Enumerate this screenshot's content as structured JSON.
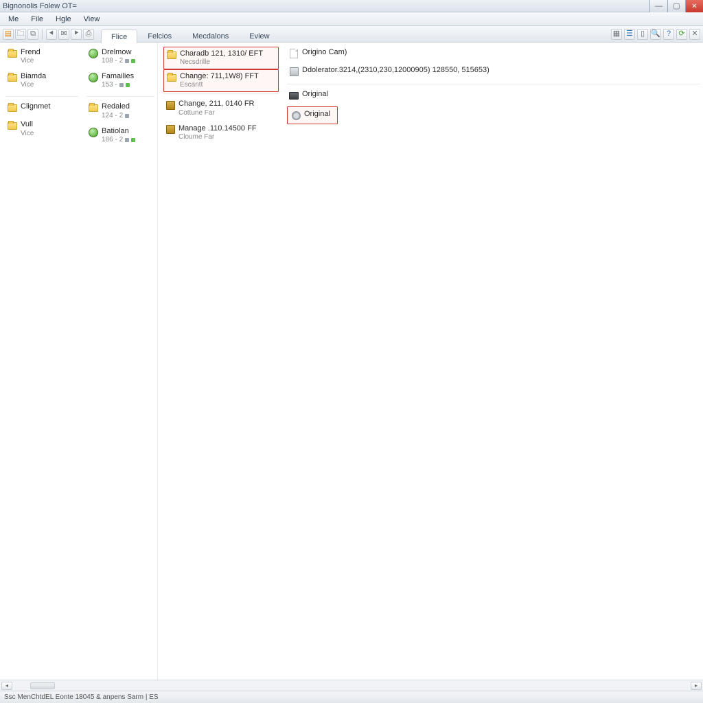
{
  "window": {
    "title": "Bignonolis Folew OT="
  },
  "menu": {
    "items": [
      "Me",
      "File",
      "Hgle",
      "View"
    ]
  },
  "tabs": {
    "items": [
      "Flice",
      "Felcios",
      "Mecdalons",
      "Eview"
    ],
    "active": 0
  },
  "toolbar_right_icons": [
    "calendar-icon",
    "list-icon",
    "page-icon",
    "search-icon",
    "help-icon",
    "refresh-icon",
    "close-small-icon"
  ],
  "col1": [
    {
      "line1": "Frend",
      "line2": "Vice"
    },
    {
      "line1": "Biamda",
      "line2": "Vice"
    },
    {
      "line1": "Clignmet",
      "line2": ""
    },
    {
      "line1": "Vull",
      "line2": "Vice"
    }
  ],
  "col2": [
    {
      "line1": "Drelmow",
      "line2": "108 - 2",
      "badge": true
    },
    {
      "line1": "Famailies",
      "line2": "153 -",
      "badge": true
    },
    {
      "line1": "Redaled",
      "line2": "124 - 2",
      "badge": false
    },
    {
      "line1": "Batiolan",
      "line2": "186 - 2",
      "badge": true
    }
  ],
  "col3": [
    {
      "line1": "Charadb 121, 1310/ EFT",
      "line2": "Necsdrille",
      "hl": true,
      "icon": "folder"
    },
    {
      "line1": "Change: 711,1W8) FFT",
      "line2": "Escantt",
      "hl": true,
      "icon": "folder"
    },
    {
      "line1": "Change, 211, 0140 FR",
      "line2": "Cottune Far",
      "hl": false,
      "icon": "chip"
    },
    {
      "line1": "Manage .110.14500 FF",
      "line2": "Cloume Far",
      "hl": false,
      "icon": "chip"
    }
  ],
  "col4": [
    {
      "line1": "Origino Cam)",
      "line2": "",
      "hl": false,
      "icon": "page"
    },
    {
      "line1": "Ddolerator.3214,(2310,230,12000905) 128550, 515653)",
      "line2": "",
      "hl": false,
      "icon": "disk"
    },
    {
      "line1": "Original",
      "line2": "",
      "hl": false,
      "icon": "monitor"
    },
    {
      "line1": "Original",
      "line2": "",
      "hl": true,
      "icon": "gear"
    }
  ],
  "status": "Ssc MenChtdEL Eonte 18045 & anpens Sarm | ES"
}
